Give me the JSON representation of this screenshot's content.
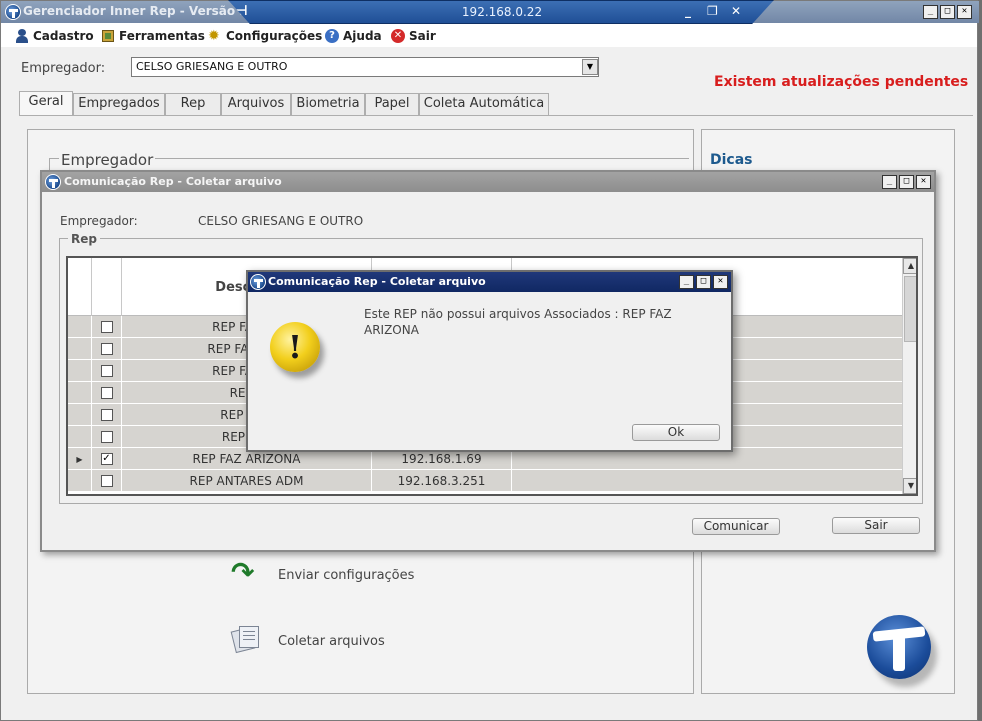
{
  "window": {
    "title": "Gerenciador Inner Rep - Versão 5...",
    "rdp_address": "192.168.0.22"
  },
  "menu": [
    {
      "label": "Cadastro",
      "icon": "user-icon"
    },
    {
      "label": "Ferramentas",
      "icon": "tools-icon"
    },
    {
      "label": "Configurações",
      "icon": "gear-icon"
    },
    {
      "label": "Ajuda",
      "icon": "help-icon"
    },
    {
      "label": "Sair",
      "icon": "exit-icon"
    }
  ],
  "employer": {
    "label": "Empregador:",
    "value": "CELSO GRIESANG E OUTRO"
  },
  "pending_updates": "Existem atualizações pendentes",
  "tabs": [
    "Geral",
    "Empregados",
    "Rep",
    "Arquivos",
    "Biometria",
    "Papel",
    "Coleta Automática"
  ],
  "active_tab": "Geral",
  "geral": {
    "section_title": "Empregador",
    "actions": [
      {
        "label": "Enviar configurações",
        "icon": "send-config-icon"
      },
      {
        "label": "Coletar arquivos",
        "icon": "collect-files-icon"
      }
    ]
  },
  "dicas": {
    "title": "Dicas"
  },
  "rep_dialog": {
    "title": "Comunicação Rep - Coletar arquivo",
    "employer_label": "Empregador:",
    "employer_value": "CELSO GRIESANG E OUTRO",
    "group_label": "Rep",
    "column_header": "Descriçã",
    "rows": [
      {
        "description": "REP FAZ TR",
        "ip": "",
        "checked": false,
        "current": false
      },
      {
        "description": "REP FAZ TRO",
        "ip": "",
        "checked": false,
        "current": false
      },
      {
        "description": "REP FAZ TR",
        "ip": "",
        "checked": false,
        "current": false
      },
      {
        "description": "REP F",
        "ip": "",
        "checked": false,
        "current": false
      },
      {
        "description": "REP TUG",
        "ip": "",
        "checked": false,
        "current": false
      },
      {
        "description": "REP FAZ",
        "ip": "",
        "checked": false,
        "current": false
      },
      {
        "description": "REP FAZ ARIZONA",
        "ip": "192.168.1.69",
        "checked": true,
        "current": true
      },
      {
        "description": "REP ANTARES ADM",
        "ip": "192.168.3.251",
        "checked": false,
        "current": false
      }
    ],
    "btn_communicate": "Comunicar",
    "btn_exit": "Sair"
  },
  "message_box": {
    "title": "Comunicação Rep - Coletar arquivo",
    "message": "Este REP não possui arquivos Associados : REP FAZ ARIZONA",
    "ok_label": "Ok",
    "icon": "warning-icon"
  },
  "colors": {
    "pending": "#d81e1e",
    "dicas": "#1d5a8e",
    "msg_titlebar": "#102863"
  }
}
